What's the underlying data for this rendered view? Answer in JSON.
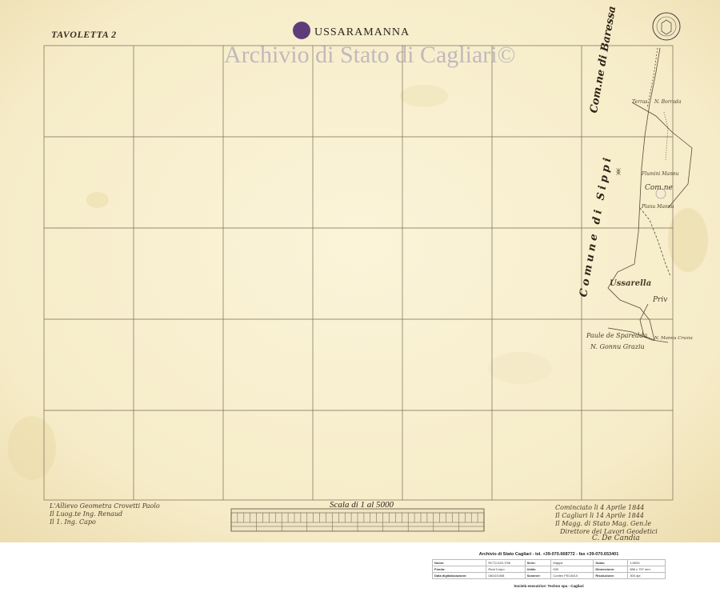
{
  "map": {
    "sheet_label": "TAVOLETTA 2",
    "place_name": "USSARAMANNA",
    "watermark": "Archivio di Stato di Cagliari©",
    "scale_label": "Scala di 1 al 5000",
    "place_labels": {
      "comune_baressa": "Com.ne di Baressa",
      "comune_sipp": "Comune di Sippi",
      "com_short": "Com.ne",
      "ussarella": "Ussarella",
      "priv": "Priv",
      "paule": "Paule de Sparedda",
      "nuraghe": "N. Gonnu Graziu",
      "fleu": "Flumini Mannu",
      "planu": "Planu Mannu",
      "barrada": "N. Borrada",
      "mannus": "N. Mannu Cruxia",
      "terras": "Terras"
    },
    "signatures_left": [
      "L'Allievo Geometra Crovetti Paolo",
      "Il Luog.te Ing. Renaud",
      "Il 1. Ing. Capo"
    ],
    "signatures_right": [
      "Cominciato li 4 Aprile 1844",
      "Il Cagliari li 14 Aprile 1844",
      "Il Magg. di Stato Mag. Gen.le",
      "Direttore dei Lavori Geodetici",
      "C. De Candia"
    ]
  },
  "footer": {
    "title": "Archivio di Stato Cagliari - tel. +39-070.668772 - fax +39-070.653401",
    "rows": [
      [
        "Nome:",
        "RCT2-020-7/96",
        "Serie:",
        "Mappe",
        "Scala:",
        "1:5000"
      ],
      [
        "Fondo:",
        "Real Corpo",
        "Unità:",
        "000",
        "Dimensione:",
        "586 x 797 mm."
      ],
      [
        "Data digitalizzazione:",
        "08/10/1008",
        "Scanner:",
        "Contex FSC4610",
        "Risoluzione:",
        "300 dpi"
      ]
    ],
    "bottom": "Società esecutrice: Techno spa - Cagliari"
  }
}
